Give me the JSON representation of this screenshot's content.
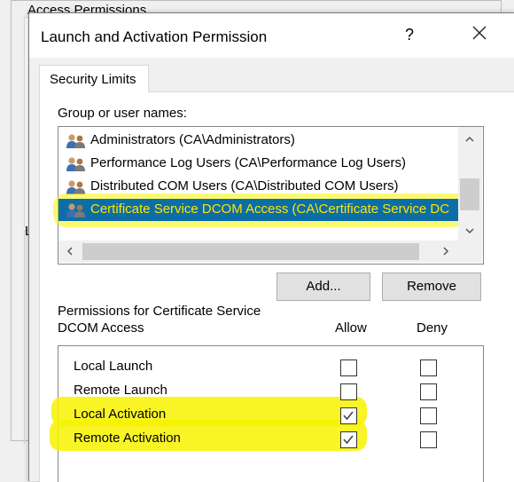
{
  "background_window": {
    "title": "Access Permissions",
    "side_letter": "L"
  },
  "dialog": {
    "title": "Launch and Activation Permission",
    "help_label": "?",
    "tab_label": "Security Limits"
  },
  "group_section": {
    "label": "Group or user names:",
    "users": [
      {
        "name": "Administrators (CA\\Administrators)",
        "selected": false,
        "icon": "users-group-icon"
      },
      {
        "name": "Performance Log Users (CA\\Performance Log Users)",
        "selected": false,
        "icon": "users-group-icon"
      },
      {
        "name": "Distributed COM Users (CA\\Distributed COM Users)",
        "selected": false,
        "icon": "users-group-icon"
      },
      {
        "name": "Certificate Service DCOM Access (CA\\Certificate Service DC",
        "selected": true,
        "icon": "users-group-icon"
      }
    ],
    "add_button": "Add...",
    "remove_button": "Remove"
  },
  "permissions_section": {
    "label_line1": "Permissions for Certificate Service",
    "label_line2": "DCOM Access",
    "allow_header": "Allow",
    "deny_header": "Deny",
    "rows": [
      {
        "name": "Local Launch",
        "allow": false,
        "deny": false,
        "highlighted": false
      },
      {
        "name": "Remote Launch",
        "allow": false,
        "deny": false,
        "highlighted": false
      },
      {
        "name": "Local Activation",
        "allow": true,
        "deny": false,
        "highlighted": true
      },
      {
        "name": "Remote Activation",
        "allow": true,
        "deny": false,
        "highlighted": true
      }
    ]
  },
  "colors": {
    "selection_bg": "#0c6ea7",
    "selection_text": "#ffe400",
    "highlighter": "#f7f200"
  }
}
